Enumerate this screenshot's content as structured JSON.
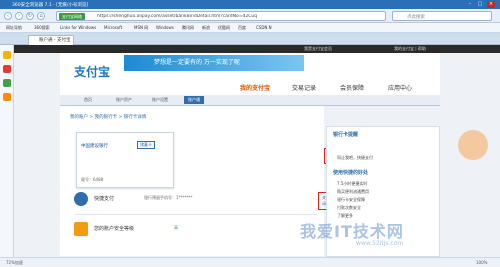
{
  "window": {
    "title": "360安全浏览器 7.1 - [无痕/小号浏览]"
  },
  "address": {
    "secure_badge": "支付宝网络",
    "url": "https://shenghuo.alipay.com/asset/bankBindDetail.htm?cardNo=d2Cuq",
    "search_placeholder": "点此搜索"
  },
  "bookmarks": [
    "网址导航",
    "360搜索",
    "Links for Windows",
    "Microsoft",
    "MSN 网",
    "Windows",
    "腾讯网",
    "新浪",
    "优酷网",
    "百度",
    "CSDN.N"
  ],
  "tab": {
    "label": "账户通 - 支付宝"
  },
  "topstrip": {
    "left": "我是支付宝会员",
    "right": "我的支付宝  |  帮助"
  },
  "header": {
    "logo": "支付宝",
    "banner": "梦想是一定要有的 万一实现了呢",
    "nav": [
      "我的支付宝",
      "交易记录",
      "会员保障",
      "应用中心"
    ]
  },
  "subnav": [
    "首页",
    "账户资产",
    "账户设置",
    "账户通"
  ],
  "breadcrumb": "我的账户 > 我的银行卡 > 银行卡详情",
  "card": {
    "bank": "中国建设银行",
    "type": "储蓄卡",
    "number": "尾号：6488"
  },
  "manage_label": "删除",
  "rows": [
    {
      "label": "快捷支付",
      "desc": "银行预留手机号：1*******",
      "link": "关闭"
    },
    {
      "label": "您的账户安全等级",
      "desc": "高",
      "link": ""
    }
  ],
  "right": {
    "title": "银行卡提醒",
    "item": "同让我吧，快捷支付",
    "section": "使用快捷的好处",
    "list": [
      "7.5小时便捷实时",
      "购买便利流通费用",
      "银行卡安全保障",
      "付款次数安全",
      "了解更多"
    ]
  },
  "status": {
    "left": "72%加速",
    "right": "100%"
  },
  "watermark": {
    "big": "我爱IT技术网",
    "small": "www.52itjs.com"
  }
}
